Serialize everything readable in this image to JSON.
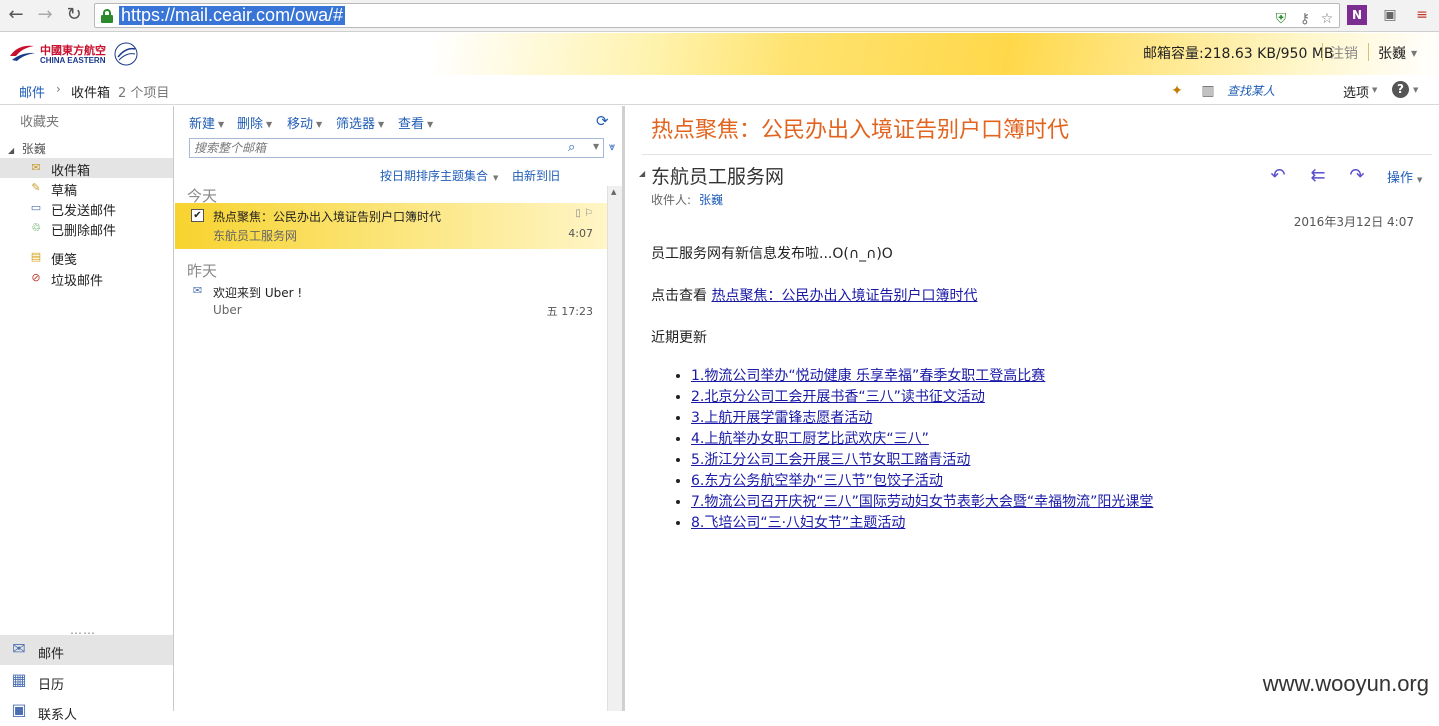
{
  "browser": {
    "url": "https://mail.ceair.com/owa/#"
  },
  "header": {
    "logo_cn": "中國東方航空",
    "logo_en": "CHINA EASTERN",
    "quota": "邮箱容量:218.63 KB/950 MB",
    "logout": "注销",
    "user": "张巍"
  },
  "breadcrumb": {
    "mail": "邮件",
    "inbox": "收件箱",
    "count": "2 个项目"
  },
  "toolbar_right": {
    "find_people": "查找某人",
    "options": "选项"
  },
  "folders": {
    "favorites": "收藏夹",
    "account": "张巍",
    "items": [
      {
        "label": "收件箱",
        "icon": "inbox-icon"
      },
      {
        "label": "草稿",
        "icon": "drafts-icon"
      },
      {
        "label": "已发送邮件",
        "icon": "sent-icon"
      },
      {
        "label": "已删除邮件",
        "icon": "trash-icon"
      },
      {
        "label": "便笺",
        "icon": "notes-icon"
      },
      {
        "label": "垃圾邮件",
        "icon": "junk-icon"
      }
    ]
  },
  "nav": {
    "mail": "邮件",
    "calendar": "日历",
    "contacts": "联系人"
  },
  "list": {
    "menu": [
      "新建",
      "删除",
      "移动",
      "筛选器",
      "查看"
    ],
    "search_placeholder": "搜索整个邮箱",
    "sort_by": "按日期排序主题集合",
    "sort_order": "由新到旧",
    "groups": [
      {
        "label": "今天",
        "messages": [
          {
            "subject": "热点聚焦：公民办出入境证告别户口簿时代",
            "from": "东航员工服务网",
            "time": "4:07",
            "selected": true
          }
        ]
      },
      {
        "label": "昨天",
        "messages": [
          {
            "subject": "欢迎来到 Uber !",
            "from": "Uber",
            "time": "五 17:23",
            "selected": false
          }
        ]
      }
    ]
  },
  "reading": {
    "subject": "热点聚焦：公民办出入境证告别户口簿时代",
    "sender": "东航员工服务网",
    "to_label": "收件人:",
    "to": "张巍",
    "date": "2016年3月12日 4:07",
    "actions": "操作",
    "intro": "员工服务网有新信息发布啦...O(∩_∩)O",
    "click_prefix": "点击查看",
    "click_link": "热点聚焦：公民办出入境证告别户口簿时代",
    "recent_title": "近期更新",
    "updates": [
      "1.物流公司举办“悦动健康 乐享幸福”春季女职工登高比赛",
      "2.北京分公司工会开展书香“三八”读书征文活动",
      "3.上航开展学雷锋志愿者活动",
      "4.上航举办女职工厨艺比武欢庆“三八”",
      "5.浙江分公司工会开展三八节女职工踏青活动",
      "6.东方公务航空举办“三八节”包饺子活动",
      "7.物流公司召开庆祝“三八”国际劳动妇女节表彰大会暨“幸福物流”阳光课堂",
      "8.飞培公司“三·八妇女节”主题活动"
    ]
  },
  "watermark": "www.wooyun.org",
  "colors": {
    "accent_link": "#1f5db7",
    "subject_orange": "#e2641e",
    "selected_row": "#f7d32e"
  }
}
